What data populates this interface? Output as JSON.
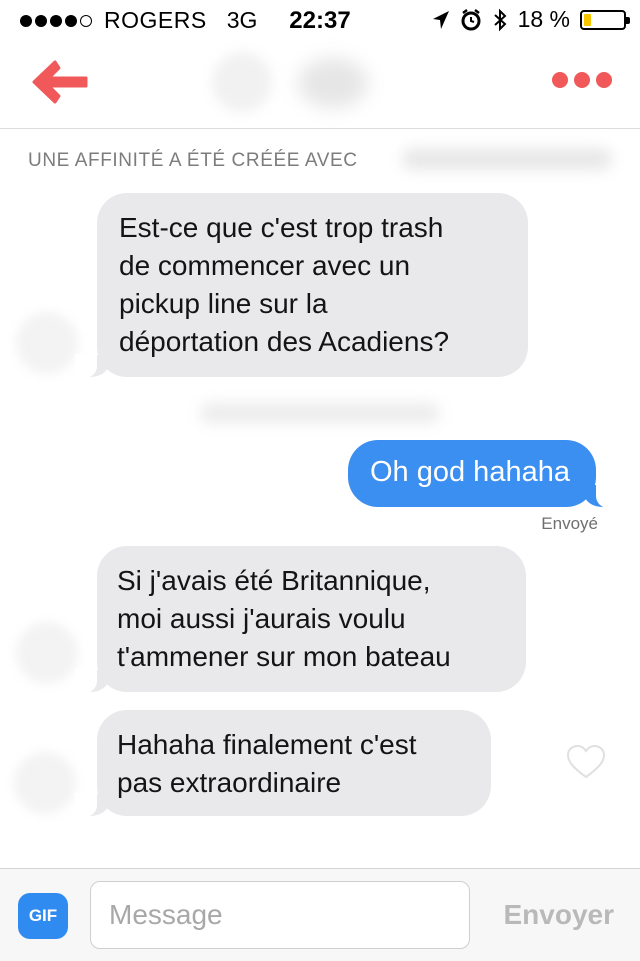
{
  "status_bar": {
    "carrier": "ROGERS",
    "network": "3G",
    "time": "22:37",
    "battery_text": "18 %",
    "battery_level": 0.18,
    "signal_dots_filled": 4
  },
  "header": {
    "back_icon": "arrow-left-icon",
    "more_icon": "more-dots-icon",
    "accent_color": "#f0585a"
  },
  "match_label": "UNE AFFINITÉ A ÉTÉ CRÉÉE AVEC",
  "messages": [
    {
      "direction": "received",
      "text": "Est-ce que c'est trop trash\nde commencer avec un\npickup line sur la\ndéportation des Acadiens?"
    },
    {
      "direction": "sent",
      "text": "Oh god hahaha",
      "status": "Envoyé"
    },
    {
      "direction": "received",
      "text": "Si j'avais été Britannique,\nmoi aussi j'aurais voulu\nt'ammener sur mon bateau"
    },
    {
      "direction": "received",
      "text": "Hahaha finalement c'est\npas extraordinaire"
    }
  ],
  "composer": {
    "gif_label": "GIF",
    "input_value": "",
    "input_placeholder": "Message",
    "send_label": "Envoyer"
  },
  "colors": {
    "sent_bubble": "#3b8ff0",
    "received_bubble": "#e9e9eb",
    "gif_button": "#2f8bf0"
  }
}
